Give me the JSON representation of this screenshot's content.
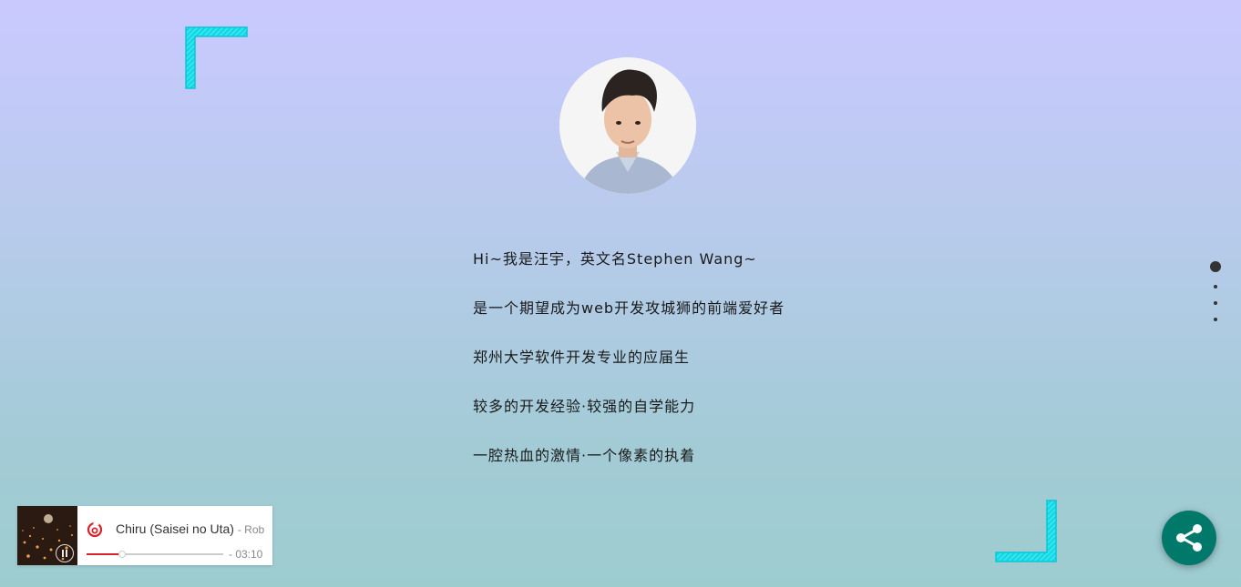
{
  "intro": {
    "lines": [
      "Hi~我是汪宇，英文名Stephen Wang~",
      "是一个期望成为web开发攻城狮的前端爱好者",
      "郑州大学软件开发专业的应届生",
      "较多的开发经验·较强的自学能力",
      "一腔热血的激情·一个像素的执着"
    ]
  },
  "player": {
    "song_title": "Chiru (Saisei no Uta)",
    "artist": "- Rob",
    "remaining_time": "- 03:10",
    "progress_fraction": 0.25,
    "brand_icon": "netease-music-icon",
    "play_state": "playing"
  },
  "section_nav": {
    "count": 4,
    "active_index": 0
  },
  "icons": {
    "share": "share-icon",
    "pause": "pause-icon"
  },
  "colors": {
    "corner_accent": "#19e3ee",
    "share_button": "#00796b",
    "progress": "#d8232a",
    "netease_red": "#d8232a"
  }
}
